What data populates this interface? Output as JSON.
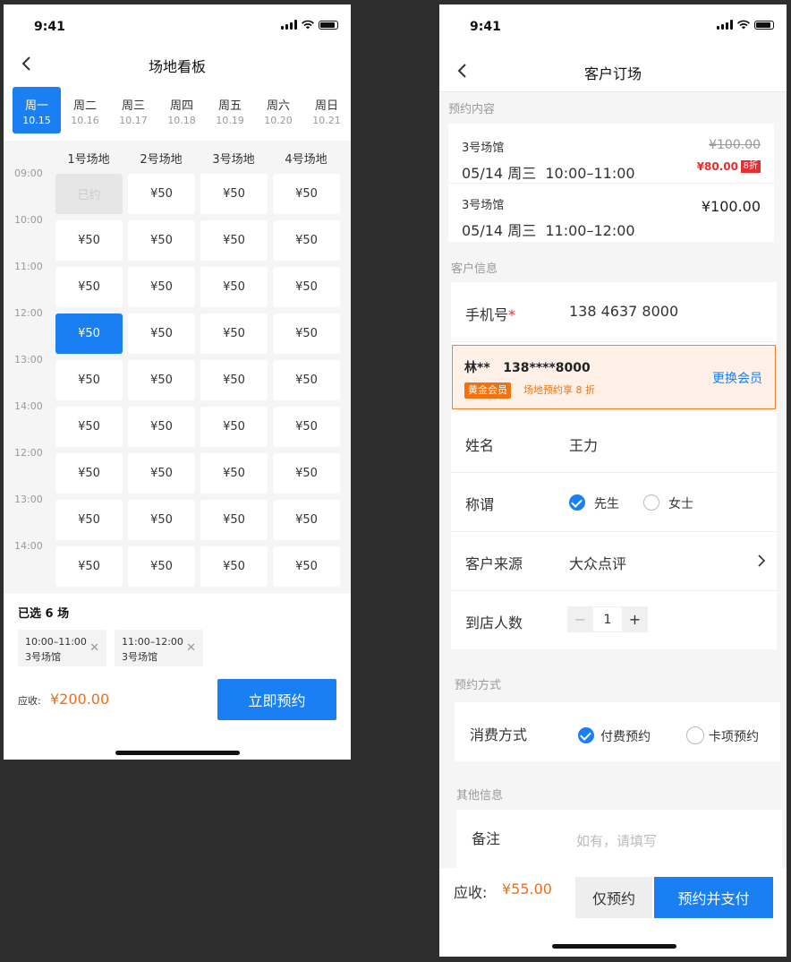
{
  "colors": {
    "accent": "#1a7ff2",
    "price": "#f56c15",
    "discount": "#e62e2e",
    "member_bg": "#fff1e8",
    "member_border": "#f57e28"
  },
  "screen1": {
    "status_time": "9:41",
    "title": "场地看板",
    "days": [
      {
        "name": "周一",
        "date": "10.15",
        "active": true
      },
      {
        "name": "周二",
        "date": "10.16"
      },
      {
        "name": "周三",
        "date": "10.17"
      },
      {
        "name": "周四",
        "date": "10.18"
      },
      {
        "name": "周五",
        "date": "10.19"
      },
      {
        "name": "周六",
        "date": "10.20"
      },
      {
        "name": "周日",
        "date": "10.21"
      }
    ],
    "courts": [
      "1号场地",
      "2号场地",
      "3号场地",
      "4号场地"
    ],
    "times": [
      "09:00",
      "10:00",
      "11:00",
      "12:00",
      "13:00",
      "14:00",
      "12:00",
      "13:00",
      "14:00"
    ],
    "grid": [
      [
        "已约",
        "¥50",
        "¥50",
        "¥50"
      ],
      [
        "¥50",
        "¥50",
        "¥50",
        "¥50"
      ],
      [
        "¥50",
        "¥50",
        "¥50",
        "¥50"
      ],
      [
        "¥50",
        "¥50",
        "¥50",
        "¥50"
      ],
      [
        "¥50",
        "¥50",
        "¥50",
        "¥50"
      ],
      [
        "¥50",
        "¥50",
        "¥50",
        "¥50"
      ],
      [
        "¥50",
        "¥50",
        "¥50",
        "¥50"
      ],
      [
        "¥50",
        "¥50",
        "¥50",
        "¥50"
      ],
      [
        "¥50",
        "¥50",
        "¥50",
        "¥50"
      ]
    ],
    "booked": [
      [
        0,
        0
      ]
    ],
    "selected": [
      [
        3,
        0
      ]
    ],
    "selected_title": "已选 6 场",
    "chips": [
      {
        "time": "10:00–11:00",
        "venue": "3号场馆"
      },
      {
        "time": "11:00–12:00",
        "venue": "3号场馆"
      }
    ],
    "due_label": "应收:",
    "due_amount": "¥200.00",
    "book_button": "立即预约"
  },
  "screen2": {
    "status_time": "9:41",
    "title": "客户订场",
    "booking_section": "预约内容",
    "bookings": [
      {
        "venue": "3号场馆",
        "date": "05/14 周三",
        "time": "10:00–11:00",
        "orig_price": "¥100.00",
        "price": "¥80.00",
        "discount": "8折"
      },
      {
        "venue": "3号场馆",
        "date": "05/14 周三",
        "time": "11:00–12:00",
        "price": "¥100.00"
      }
    ],
    "customer_section": "客户信息",
    "phone_label": "手机号",
    "phone_required": "*",
    "phone_value": "138 4637 8000",
    "member": {
      "name": "林**",
      "phone": "138****8000",
      "level": "黄金会员",
      "perk": "场地预约享 8 折",
      "change": "更换会员"
    },
    "name_label": "姓名",
    "name_value": "王力",
    "title_label": "称谓",
    "title_options": [
      {
        "label": "先生",
        "checked": true
      },
      {
        "label": "女士",
        "checked": false
      }
    ],
    "source_label": "客户来源",
    "source_value": "大众点评",
    "count_label": "到店人数",
    "count_value": "1",
    "count_minus": "−",
    "count_plus": "+",
    "method_section": "预约方式",
    "method_label": "消费方式",
    "method_options": [
      {
        "label": "付费预约",
        "checked": true
      },
      {
        "label": "卡项预约",
        "checked": false
      }
    ],
    "other_section": "其他信息",
    "remark_label": "备注",
    "remark_placeholder": "如有，请填写",
    "due_label": "应收:",
    "due_amount": "¥55.00",
    "reserve_button": "仅预约",
    "reserve_pay_button": "预约并支付"
  }
}
